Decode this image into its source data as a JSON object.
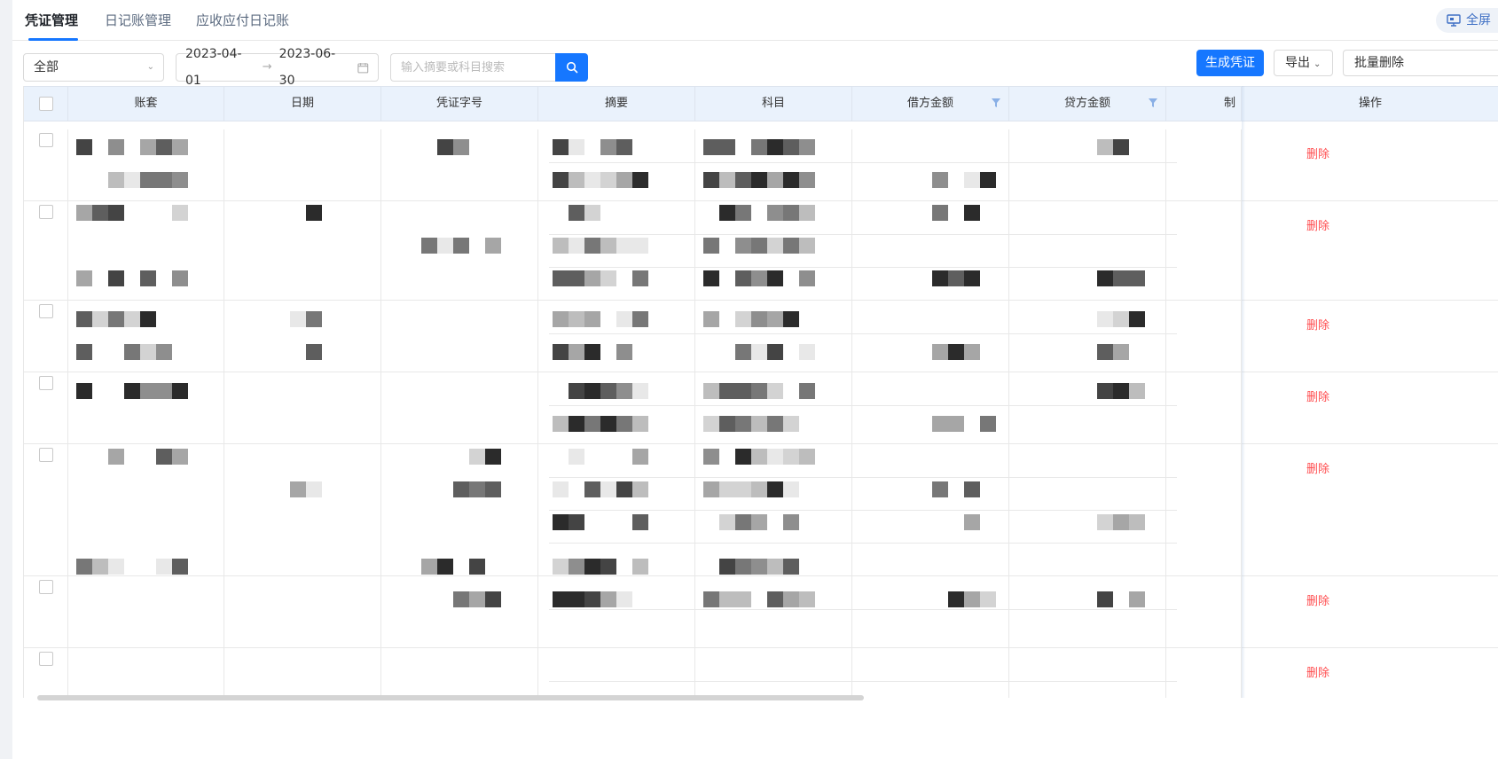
{
  "tabs": [
    {
      "label": "凭证管理",
      "active": true
    },
    {
      "label": "日记账管理",
      "active": false
    },
    {
      "label": "应收应付日记账",
      "active": false
    }
  ],
  "fullscreen_label": "全屏",
  "toolbar": {
    "ledger_select": "全部",
    "date_start": "2023-04-01",
    "date_end": "2023-06-30",
    "search_placeholder": "输入摘要或科目搜索",
    "generate_label": "生成凭证",
    "export_label": "导出",
    "batch_delete_label": "批量删除"
  },
  "table": {
    "columns": [
      "账套",
      "日期",
      "凭证字号",
      "摘要",
      "科目",
      "借方金额",
      "贷方金额",
      "制",
      "操作"
    ],
    "rows": [
      {
        "action": "删除"
      },
      {
        "action": "删除"
      },
      {
        "action": "删除"
      },
      {
        "action": "删除"
      },
      {
        "action": "删除"
      },
      {
        "action": "删除"
      },
      {
        "action": "删除"
      }
    ]
  },
  "colors": {
    "primary": "#1677ff",
    "danger": "#ff4d4f",
    "header_bg": "#eaf2fc"
  }
}
